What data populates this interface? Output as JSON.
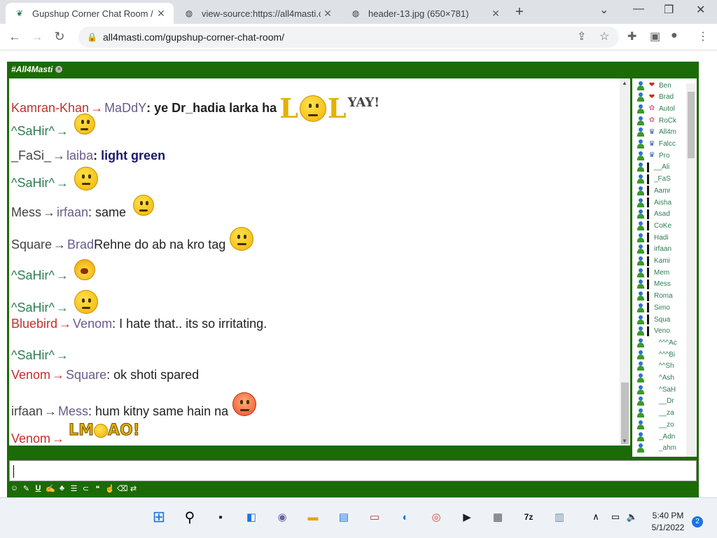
{
  "browser": {
    "tabs": [
      {
        "title": "Gupshup Corner Chat Room / Gu",
        "active": true
      },
      {
        "title": "view-source:https://all4masti.con",
        "active": false
      },
      {
        "title": "header-13.jpg (650×781)",
        "active": false
      }
    ],
    "url": "all4masti.com/gupshup-corner-chat-room/"
  },
  "room": {
    "tab_label": "#All4Masti"
  },
  "messages": [
    {
      "sender": "Kamran-Khan",
      "to": "MaDdY",
      "text": ": ye Dr_hadia larka ha",
      "emote": "LOL YAY!",
      "bold": true
    },
    {
      "sender": "^SaHir^",
      "to": "",
      "text": "",
      "emote": "pigtail-smiley"
    },
    {
      "sender": "_FaSi_",
      "to": "laiba",
      "text": ": light green",
      "bold": true
    },
    {
      "sender": "^SaHir^",
      "to": "",
      "text": "",
      "emote": "neutral-smiley"
    },
    {
      "sender": "Mess",
      "to": "irfaan",
      "text": ": same",
      "emote": "pigtail-smiley"
    },
    {
      "sender": "Square",
      "to": "Brad",
      "text": " Rehne do ab na kro tag",
      "emote": "neutral-smiley"
    },
    {
      "sender": "^SaHir^",
      "to": "",
      "text": "",
      "emote": "crying-smiley"
    },
    {
      "sender": "^SaHir^",
      "to": "",
      "text": "",
      "emote": "sad-smiley"
    },
    {
      "sender": "Bluebird",
      "to": "Venom",
      "text": ": I hate that.. its so irritating."
    },
    {
      "sender": "^SaHir^",
      "to": "",
      "text": ""
    },
    {
      "sender": "Venom",
      "to": "Square",
      "text": ": ok shoti spared"
    },
    {
      "sender": "irfaan",
      "to": "Mess",
      "text": ": hum kitny same hain na",
      "emote": "blush-smiley"
    },
    {
      "sender": "Venom",
      "to": "",
      "text": "",
      "emote": "LMAO!"
    }
  ],
  "emote_text": {
    "lol_l1": "L",
    "lol_l2": "L",
    "yay": "YAY!",
    "lmao_a": "LM",
    "lmao_b": "AO!"
  },
  "arrow_glyph": "→",
  "users": [
    {
      "name": "Ben",
      "badge": "heart"
    },
    {
      "name": "Brad",
      "badge": "heart"
    },
    {
      "name": "Autol",
      "badge": "flower"
    },
    {
      "name": "RoCk",
      "badge": "flower"
    },
    {
      "name": "All4m",
      "badge": "crown"
    },
    {
      "name": "Falcc",
      "badge": "crown"
    },
    {
      "name": "Pro",
      "badge": "crown"
    },
    {
      "name": "__Ali",
      "badge": "bar"
    },
    {
      "name": "_FaS",
      "badge": "bar"
    },
    {
      "name": "Aamr",
      "badge": "bar"
    },
    {
      "name": "Aisha",
      "badge": "bar"
    },
    {
      "name": "Asad",
      "badge": "bar"
    },
    {
      "name": "CoKe",
      "badge": "bar"
    },
    {
      "name": "Hadi",
      "badge": "bar"
    },
    {
      "name": "irfaan",
      "badge": "bar"
    },
    {
      "name": "Kami",
      "badge": "bar"
    },
    {
      "name": "Mem",
      "badge": "bar"
    },
    {
      "name": "Mess",
      "badge": "bar"
    },
    {
      "name": "Roma",
      "badge": "bar"
    },
    {
      "name": "Simo",
      "badge": "bar"
    },
    {
      "name": "Squa",
      "badge": "bar"
    },
    {
      "name": "Veno",
      "badge": "bar"
    },
    {
      "name": "^^^Ac",
      "badge": "none"
    },
    {
      "name": "^^^Bi",
      "badge": "none"
    },
    {
      "name": "^^Sh",
      "badge": "none"
    },
    {
      "name": "^Ash",
      "badge": "none"
    },
    {
      "name": "^SaH",
      "badge": "none"
    },
    {
      "name": "__Dr",
      "badge": "none"
    },
    {
      "name": "__za",
      "badge": "none"
    },
    {
      "name": "__zo",
      "badge": "none"
    },
    {
      "name": "_Adn",
      "badge": "none"
    },
    {
      "name": "_ahm",
      "badge": "none"
    }
  ],
  "taskbar": {
    "time": "5:40 PM",
    "date": "5/1/2022",
    "notifications": "2"
  },
  "colors": {
    "frame": "#1b6b06",
    "sender_red": "#c0312b",
    "sender_green": "#2e7d53",
    "recipient": "#6a5a8c"
  }
}
